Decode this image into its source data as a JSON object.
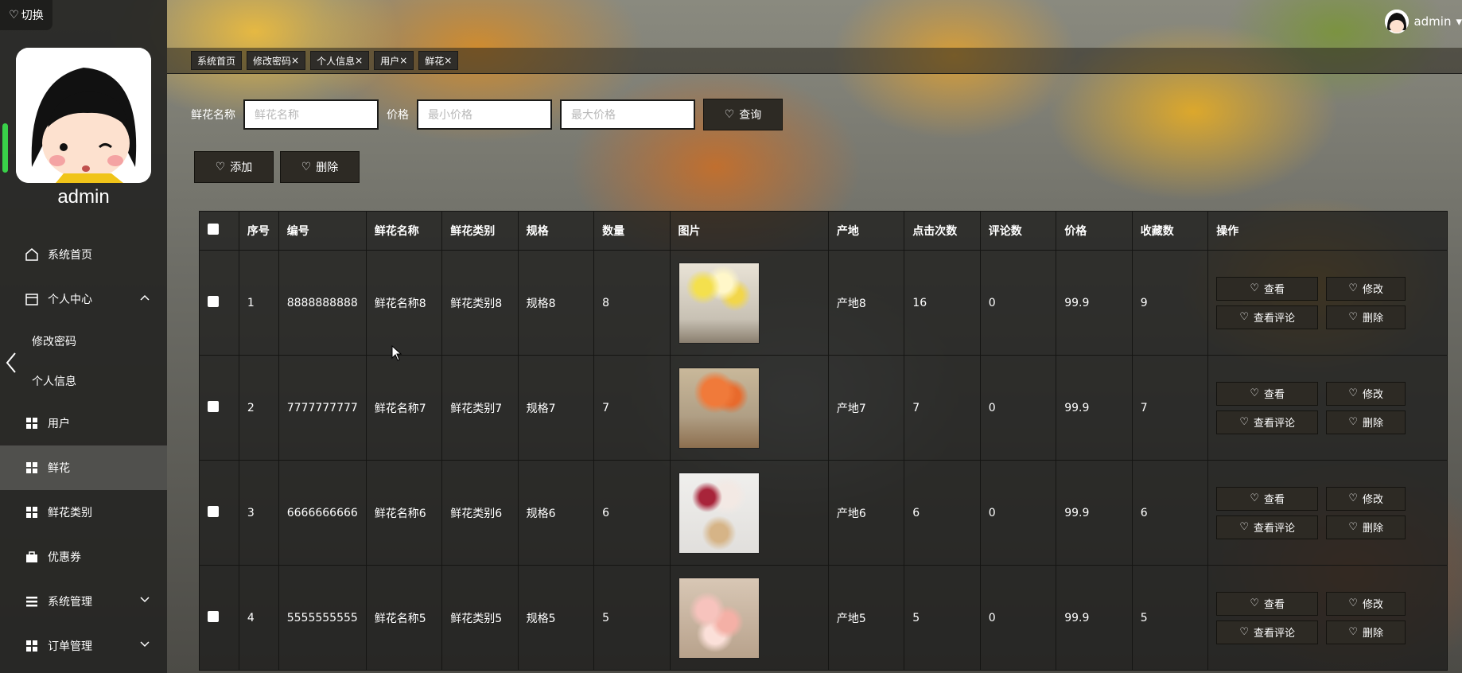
{
  "sidebar": {
    "switch_label": "切换",
    "admin_name": "admin",
    "menu": [
      {
        "label": "系统首页",
        "icon": "home-icon"
      },
      {
        "label": "个人中心",
        "icon": "calendar-icon"
      },
      {
        "label": "用户",
        "icon": "grid-icon"
      },
      {
        "label": "鲜花",
        "icon": "grid-icon"
      },
      {
        "label": "鲜花类别",
        "icon": "grid-icon"
      },
      {
        "label": "优惠券",
        "icon": "briefcase-icon"
      },
      {
        "label": "系统管理",
        "icon": "list-icon"
      },
      {
        "label": "订单管理",
        "icon": "grid-icon"
      }
    ],
    "submenu": [
      "修改密码",
      "个人信息"
    ]
  },
  "header": {
    "user": "admin"
  },
  "tabs": [
    "系统首页",
    "修改密码",
    "个人信息",
    "用户",
    "鲜花"
  ],
  "tab_close": "×",
  "search": {
    "name_label": "鲜花名称",
    "name_placeholder": "鲜花名称",
    "price_label": "价格",
    "min_placeholder": "最小价格",
    "max_placeholder": "最大价格",
    "query_label": "查询"
  },
  "actions": {
    "add_label": "添加",
    "delete_label": "删除"
  },
  "table": {
    "headers": [
      "序号",
      "编号",
      "鲜花名称",
      "鲜花类别",
      "规格",
      "数量",
      "图片",
      "产地",
      "点击次数",
      "评论数",
      "价格",
      "收藏数",
      "操作"
    ],
    "rows": [
      {
        "idx": "1",
        "code": "8888888888",
        "name": "鲜花名称8",
        "category": "鲜花类别8",
        "spec": "规格8",
        "qty": "8",
        "origin": "产地8",
        "clicks": "16",
        "comments": "0",
        "price": "99.9",
        "favs": "9"
      },
      {
        "idx": "2",
        "code": "7777777777",
        "name": "鲜花名称7",
        "category": "鲜花类别7",
        "spec": "规格7",
        "qty": "7",
        "origin": "产地7",
        "clicks": "7",
        "comments": "0",
        "price": "99.9",
        "favs": "7"
      },
      {
        "idx": "3",
        "code": "6666666666",
        "name": "鲜花名称6",
        "category": "鲜花类别6",
        "spec": "规格6",
        "qty": "6",
        "origin": "产地6",
        "clicks": "6",
        "comments": "0",
        "price": "99.9",
        "favs": "6"
      },
      {
        "idx": "4",
        "code": "5555555555",
        "name": "鲜花名称5",
        "category": "鲜花类别5",
        "spec": "规格5",
        "qty": "5",
        "origin": "产地5",
        "clicks": "5",
        "comments": "0",
        "price": "99.9",
        "favs": "5"
      }
    ],
    "ops": {
      "view": "查看",
      "edit": "修改",
      "view_comments": "查看评论",
      "delete": "删除"
    }
  },
  "colors": {
    "sidebar_bg": "#262624",
    "button_bg": "#2d2a24",
    "accent_green": "#39d149"
  }
}
